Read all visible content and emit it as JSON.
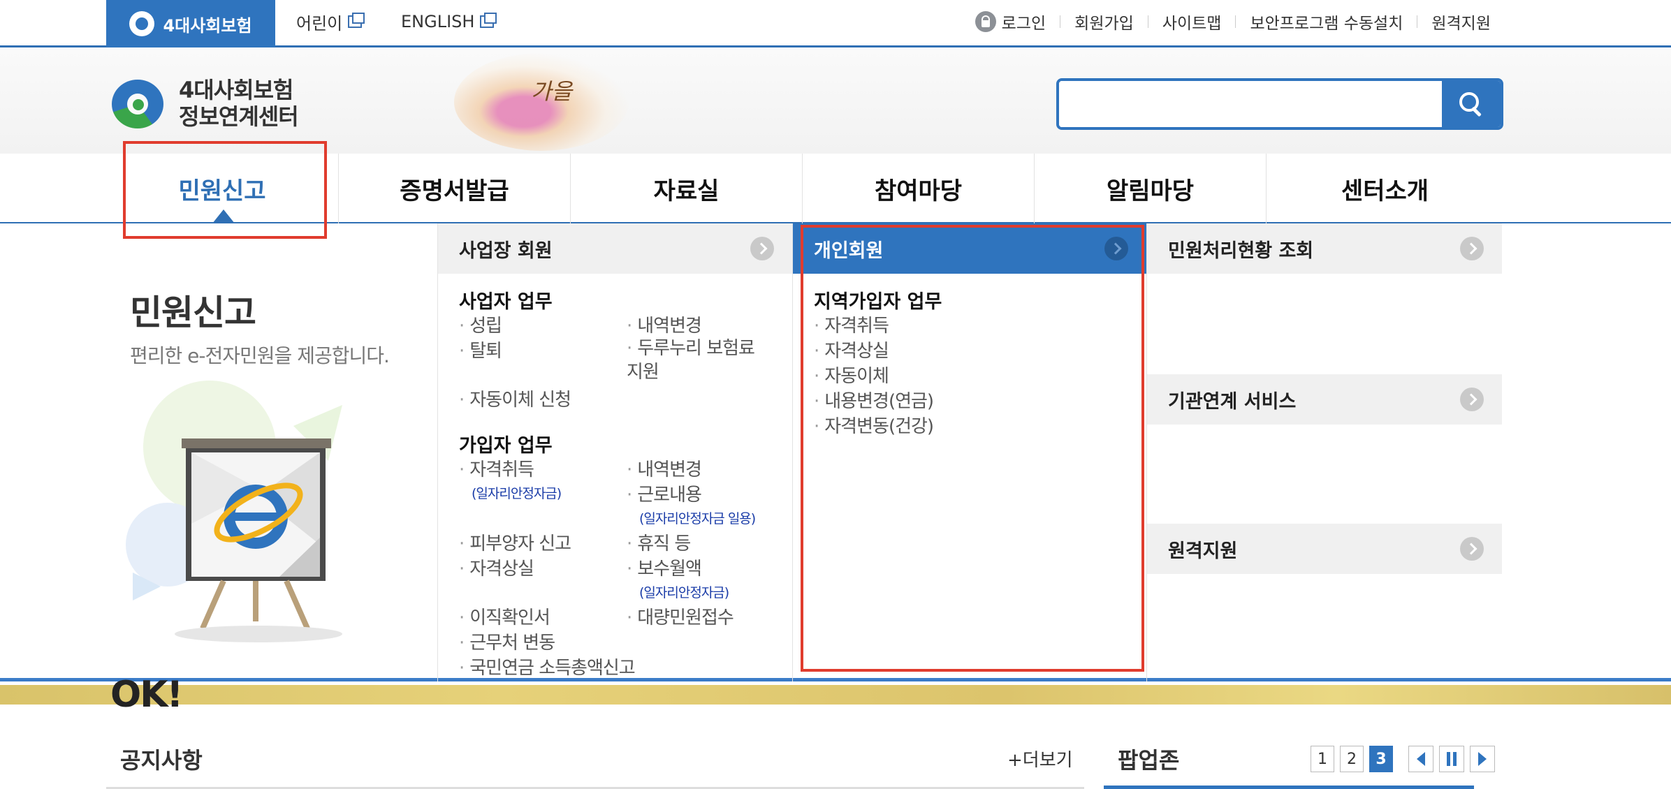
{
  "colors": {
    "primary": "#2f74be",
    "highlight": "#e03c2e",
    "note": "#1a3ca8"
  },
  "top": {
    "brand": "4대사회보험",
    "links": [
      {
        "label": "어린이",
        "icon": "external-window-icon"
      },
      {
        "label": "ENGLISH",
        "icon": "external-window-icon"
      }
    ],
    "util": [
      "로그인",
      "회원가입",
      "사이트맵",
      "보안프로그램 수동설치",
      "원격지원"
    ],
    "login_icon": "lock-icon"
  },
  "header": {
    "logo_line1": "4대사회보험",
    "logo_line2": "정보연계센터",
    "deco_text": "가을",
    "search": {
      "value": "",
      "icon": "search-icon"
    }
  },
  "nav": [
    "민원신고",
    "증명서발급",
    "자료실",
    "참여마당",
    "알림마당",
    "센터소개"
  ],
  "mega": {
    "intro_title": "민원신고",
    "intro_sub": "편리한 e-전자민원을 제공합니다.",
    "business": {
      "head": "사업장 회원",
      "sec1": "사업자 업무",
      "sec1_items": [
        "성립",
        "내역변경",
        "탈퇴",
        "두루누리 보험료 지원",
        "자동이체 신청"
      ],
      "sec2": "가입자 업무",
      "sec2_items": [
        "자격취득",
        "내역변경",
        "근로내용",
        "피부양자 신고",
        "휴직 등",
        "자격상실",
        "보수월액",
        "이직확인서",
        "대량민원접수",
        "근무처 변동",
        "국민연금 소득총액신고"
      ],
      "notes": [
        "(일자리안정자금)",
        "(일자리안정자금 일용)",
        "(일자리안정자금)"
      ]
    },
    "personal": {
      "head": "개인회원",
      "sec": "지역가입자 업무",
      "items": [
        "자격취득",
        "자격상실",
        "자동이체",
        "내용변경(연금)",
        "자격변동(건강)"
      ]
    },
    "right": [
      "민원처리현황 조회",
      "기관연계 서비스",
      "원격지원"
    ]
  },
  "bottom": {
    "banner_text": "OK!",
    "notice_title": "공지사항",
    "notice_more": "+더보기",
    "popup_title": "팝업존",
    "pages": [
      "1",
      "2",
      "3"
    ]
  }
}
